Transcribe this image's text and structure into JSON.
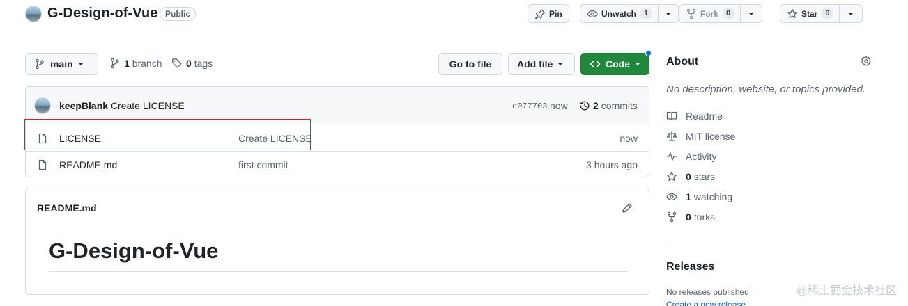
{
  "header": {
    "repo_name": "G-Design-of-Vue",
    "visibility": "Public",
    "pin_label": "Pin",
    "unwatch_label": "Unwatch",
    "watch_count": "1",
    "fork_label": "Fork",
    "fork_count": "0",
    "star_label": "Star",
    "star_count": "0"
  },
  "branch_bar": {
    "branch": "main",
    "branch_count": "1",
    "branch_word": "branch",
    "tag_count": "0",
    "tag_word": "tags",
    "go_to_file": "Go to file",
    "add_file": "Add file",
    "code": "Code"
  },
  "commit": {
    "author": "keepBlank",
    "message": "Create LICENSE",
    "sha": "e077703",
    "time": "now",
    "commit_count": "2",
    "commit_word": "commits"
  },
  "files": [
    {
      "name": "LICENSE",
      "message": "Create LICENSE",
      "time": "now"
    },
    {
      "name": "README.md",
      "message": "first commit",
      "time": "3 hours ago"
    }
  ],
  "readme": {
    "filename": "README.md",
    "heading": "G-Design-of-Vue"
  },
  "sidebar": {
    "about_title": "About",
    "description": "No description, website, or topics provided.",
    "readme": "Readme",
    "license": "MIT license",
    "activity": "Activity",
    "stars_count": "0",
    "stars_word": "stars",
    "watching_count": "1",
    "watching_word": "watching",
    "forks_count": "0",
    "forks_word": "forks",
    "releases_title": "Releases",
    "no_releases": "No releases published",
    "create_release": "Create a new release"
  },
  "watermark": "@稀土掘金技术社区",
  "colors": {
    "code_button": "#1f883d",
    "link": "#0969da",
    "highlight_border": "#d1242f"
  }
}
